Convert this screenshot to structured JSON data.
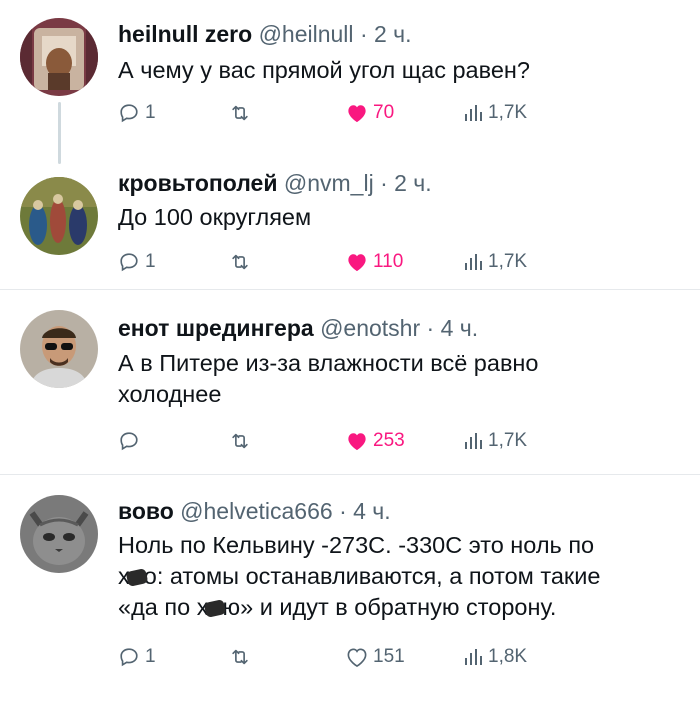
{
  "tweets": [
    {
      "name": "heilnull zero",
      "handle": "@heilnull",
      "time": "· 2 ч.",
      "text": "А чему у вас прямой угол щас равен?",
      "replies": "1",
      "likes": "70",
      "views": "1,7K",
      "liked": true
    },
    {
      "name": "кровьтополей",
      "handle": "@nvm_lj",
      "time": "· 2 ч.",
      "text": "До 100 округляем",
      "replies": "1",
      "likes": "110",
      "views": "1,7K",
      "liked": true
    },
    {
      "name": "енот шредингера",
      "handle": "@enotshr",
      "time": "· 4 ч.",
      "text_line1": "А в Питере из-за влажности всё равно",
      "text_line2": "холоднее",
      "replies": "",
      "likes": "253",
      "views": "1,7K",
      "liked": true
    },
    {
      "name": "вово",
      "handle": "@helvetica666",
      "time": "· 4 ч.",
      "text_line1": "Ноль по Кельвину -273С. -330С это ноль по",
      "text_line2_a": "х",
      "text_line2_b": "о: атомы останавливаются, а потом такие",
      "text_line3_a": "«да по х",
      "text_line3_b": "ю» и идут в обратную сторону.",
      "replies": "1",
      "likes": "151",
      "views": "1,8K",
      "liked": false
    }
  ],
  "colors": {
    "like_active": "#f91880",
    "muted": "#536471",
    "divider": "#e6e9ec"
  },
  "icons": [
    "reply-icon",
    "retweet-icon",
    "heart-icon",
    "views-icon"
  ]
}
